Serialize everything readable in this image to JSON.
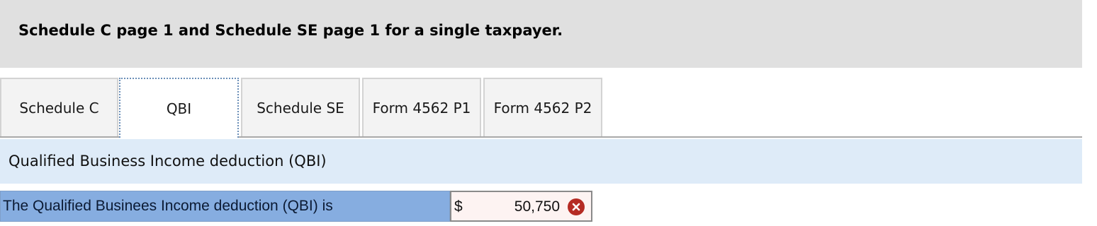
{
  "header": {
    "title": "Schedule C page 1 and Schedule SE page 1 for a single taxpayer."
  },
  "tabs": [
    {
      "label": "Schedule C",
      "active": false
    },
    {
      "label": "QBI",
      "active": true
    },
    {
      "label": "Schedule SE",
      "active": false
    },
    {
      "label": "Form 4562 P1",
      "active": false
    },
    {
      "label": "Form 4562 P2",
      "active": false
    }
  ],
  "section": {
    "title": "Qualified Business Income deduction (QBI)"
  },
  "qbi_row": {
    "label": "The Qualified Businees Income deduction (QBI) is",
    "currency": "$",
    "value": "50,750",
    "status_icon": "error-x-icon",
    "status_color": "#b52b24"
  },
  "colors": {
    "header_bg": "#e0e0e0",
    "section_bg": "#deebf8",
    "label_bg": "#86ade0",
    "input_bg": "#fdf3f2"
  }
}
